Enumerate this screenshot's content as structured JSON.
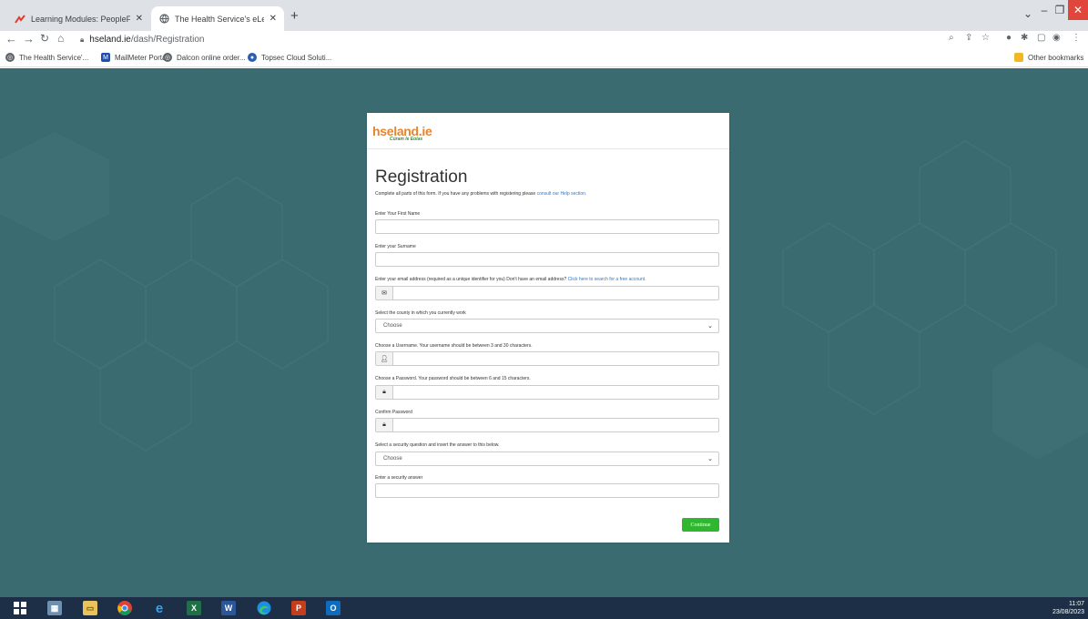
{
  "browser": {
    "tabs": [
      {
        "label": "Learning Modules: PeopleFluent",
        "favicon": "peoplefluent-icon",
        "active": false
      },
      {
        "label": "The Health Service's eLearning a",
        "favicon": "globe-icon",
        "active": true
      }
    ],
    "new_tab": "+",
    "address": {
      "host": "hseland.ie",
      "path": "/dash/Registration"
    },
    "bookmarks": [
      {
        "label": "The Health Service'...",
        "icon": "globe-icon"
      },
      {
        "label": "MailMeter Portal",
        "icon": "mailmeter-icon"
      },
      {
        "label": "Dalcon online order...",
        "icon": "globe-icon"
      },
      {
        "label": "Topsec Cloud Soluti...",
        "icon": "topsec-icon"
      }
    ],
    "other_bookmarks": "Other bookmarks"
  },
  "site": {
    "logo": "hseland.ie",
    "tagline": "Cúram le Eolas"
  },
  "form": {
    "title": "Registration",
    "intro": "Complete all parts of this form. If you have any problems with registering please",
    "intro_link": "consult our Help section.",
    "first_name_label": "Enter Your First Name",
    "surname_label": "Enter your Surname",
    "email_label": "Enter your email address (required as a unique identifier for you) Don't have an email address?",
    "email_link": "Click here to search for a free account.",
    "county_label": "Select the county in which you currently work",
    "county_value": "Choose",
    "username_label": "Choose a Username. Your username should be between 3 and 30 characters.",
    "password_label": "Choose a Password. Your password should be between 6 and 15 characters.",
    "confirm_label": "Confirm Password",
    "question_label": "Select a security question and insert the answer to this below.",
    "question_value": "Choose",
    "answer_label": "Enter a security answer",
    "continue_label": "Continue"
  },
  "taskbar": {
    "apps": [
      "windows-start-icon",
      "calculator-icon",
      "file-explorer-icon",
      "chrome-icon",
      "internet-explorer-icon",
      "excel-icon",
      "word-icon",
      "edge-icon",
      "powerpoint-icon",
      "outlook-icon"
    ],
    "time": "11:07",
    "date": "23/08/2023"
  }
}
